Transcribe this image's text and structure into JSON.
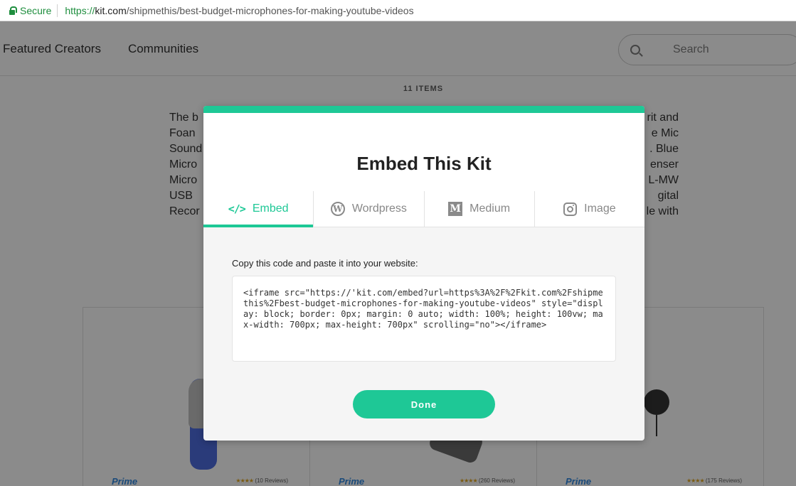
{
  "browser": {
    "secure_label": "Secure",
    "url_scheme": "https://",
    "url_host": "kit.com",
    "url_path": "/shipmethis/best-budget-microphones-for-making-youtube-videos"
  },
  "nav": {
    "items": [
      "Featured Creators",
      "Communities"
    ],
    "search_placeholder": "Search"
  },
  "kit": {
    "items_count": "11 ITEMS",
    "description_visible": "The b ... rit and Foam ... e Mic Sound ... . Blue Micro ... enser Micro ... L-MW USB ... gital Recor ... le with"
  },
  "cards": [
    {
      "badge": "Prime",
      "reviews": "(10 Reviews)"
    },
    {
      "badge": "Prime",
      "reviews": "(260 Reviews)"
    },
    {
      "badge": "Prime",
      "reviews": "(175 Reviews)"
    }
  ],
  "modal": {
    "title": "Embed This Kit",
    "tabs": [
      {
        "label": "Embed",
        "icon": "code-icon",
        "active": true
      },
      {
        "label": "Wordpress",
        "icon": "wordpress-icon",
        "active": false
      },
      {
        "label": "Medium",
        "icon": "medium-icon",
        "active": false
      },
      {
        "label": "Image",
        "icon": "instagram-icon",
        "active": false
      }
    ],
    "instructions": "Copy this code and paste it into your website:",
    "embed_code": "<iframe src=\"https://'kit.com/embed?url=https%3A%2F%2Fkit.com%2Fshipmethis%2Fbest-budget-microphones-for-making-youtube-videos\" style=\"display: block; border: 0px; margin: 0 auto; width: 100%; height: 100vw; max-width: 700px; max-height: 700px\" scrolling=\"no\"></iframe>",
    "done_label": "Done"
  },
  "colors": {
    "accent": "#1ec896",
    "secure": "#1e8e3e",
    "overlay": "#8b8b8b"
  }
}
